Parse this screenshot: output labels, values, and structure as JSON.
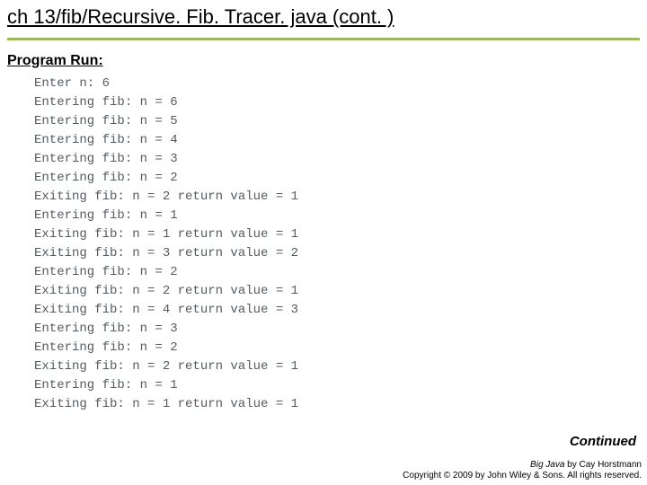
{
  "title": "ch 13/fib/Recursive. Fib. Tracer. java (cont. )",
  "subhead": "Program Run:",
  "console": "Enter n: 6\nEntering fib: n = 6\nEntering fib: n = 5\nEntering fib: n = 4\nEntering fib: n = 3\nEntering fib: n = 2\nExiting fib: n = 2 return value = 1\nEntering fib: n = 1\nExiting fib: n = 1 return value = 1\nExiting fib: n = 3 return value = 2\nEntering fib: n = 2\nExiting fib: n = 2 return value = 1\nExiting fib: n = 4 return value = 3\nEntering fib: n = 3\nEntering fib: n = 2\nExiting fib: n = 2 return value = 1\nEntering fib: n = 1\nExiting fib: n = 1 return value = 1",
  "continued": "Continued",
  "footer": {
    "book": "Big Java",
    "author": " by Cay Horstmann",
    "copyright": "Copyright © 2009 by John Wiley & Sons.  All rights reserved."
  }
}
